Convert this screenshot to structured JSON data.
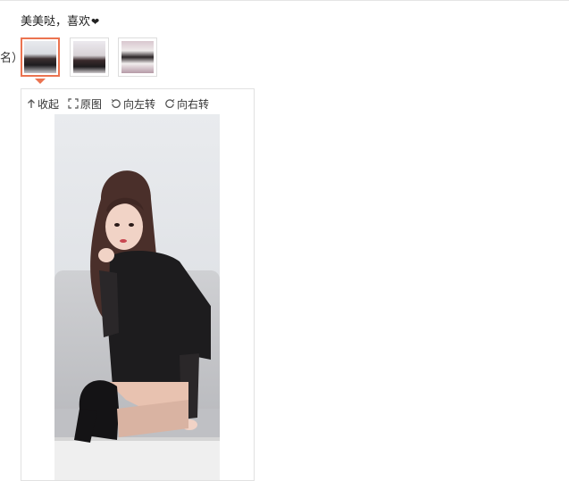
{
  "post": {
    "text": "美美哒，喜欢",
    "heart": "❤"
  },
  "left_fragment": "名）",
  "toolbar": {
    "collapse": "收起",
    "original": "原图",
    "rotate_left": "向左转",
    "rotate_right": "向右转"
  },
  "colors": {
    "accent": "#eb7350",
    "border": "#e1e1e1"
  },
  "thumbnails": {
    "count": 3,
    "selected": 1
  }
}
